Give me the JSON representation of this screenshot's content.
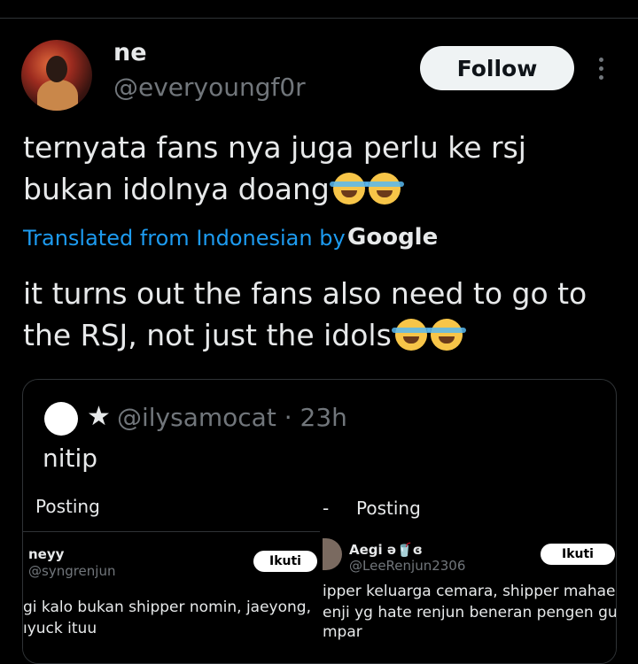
{
  "author": {
    "name": "ne",
    "handle": "@everyoungf0r"
  },
  "follow_label": "Follow",
  "tweet": {
    "text": "ternyata fans nya juga perlu ke rsj bukan idolnya doang",
    "translated_label": "Translated from Indonesian by",
    "translator": "Google",
    "translation": "it turns out the fans also need to go to the RSJ, not just the idols"
  },
  "quote": {
    "star": "★",
    "handle_time": "@ilysamocat · 23h",
    "text": "nitip",
    "left": {
      "header": "Posting",
      "name": "neyy",
      "handle": "@syngrenjun",
      "follow": "Ikuti",
      "line1": "gi kalo bukan shipper nomin, jaeyong,",
      "line2": "ıyuck ituu"
    },
    "right": {
      "dash": "-",
      "header": "Posting",
      "name": "Aegi ə🥤ɞ",
      "handle": "@LeeRenjun2306",
      "follow": "Ikuti",
      "line1": "ipper keluarga cemara, shipper mahae nomi",
      "line2": "enji yg hate renjun beneran pengen gue",
      "line3": "mpar"
    }
  },
  "colors": {
    "accent": "#1d9bf0",
    "muted": "#71767b",
    "text": "#e7e9ea",
    "background": "#000000"
  },
  "icons": {
    "more": "more-vertical-icon",
    "emoji": "face-with-tears-of-joy-icon"
  }
}
